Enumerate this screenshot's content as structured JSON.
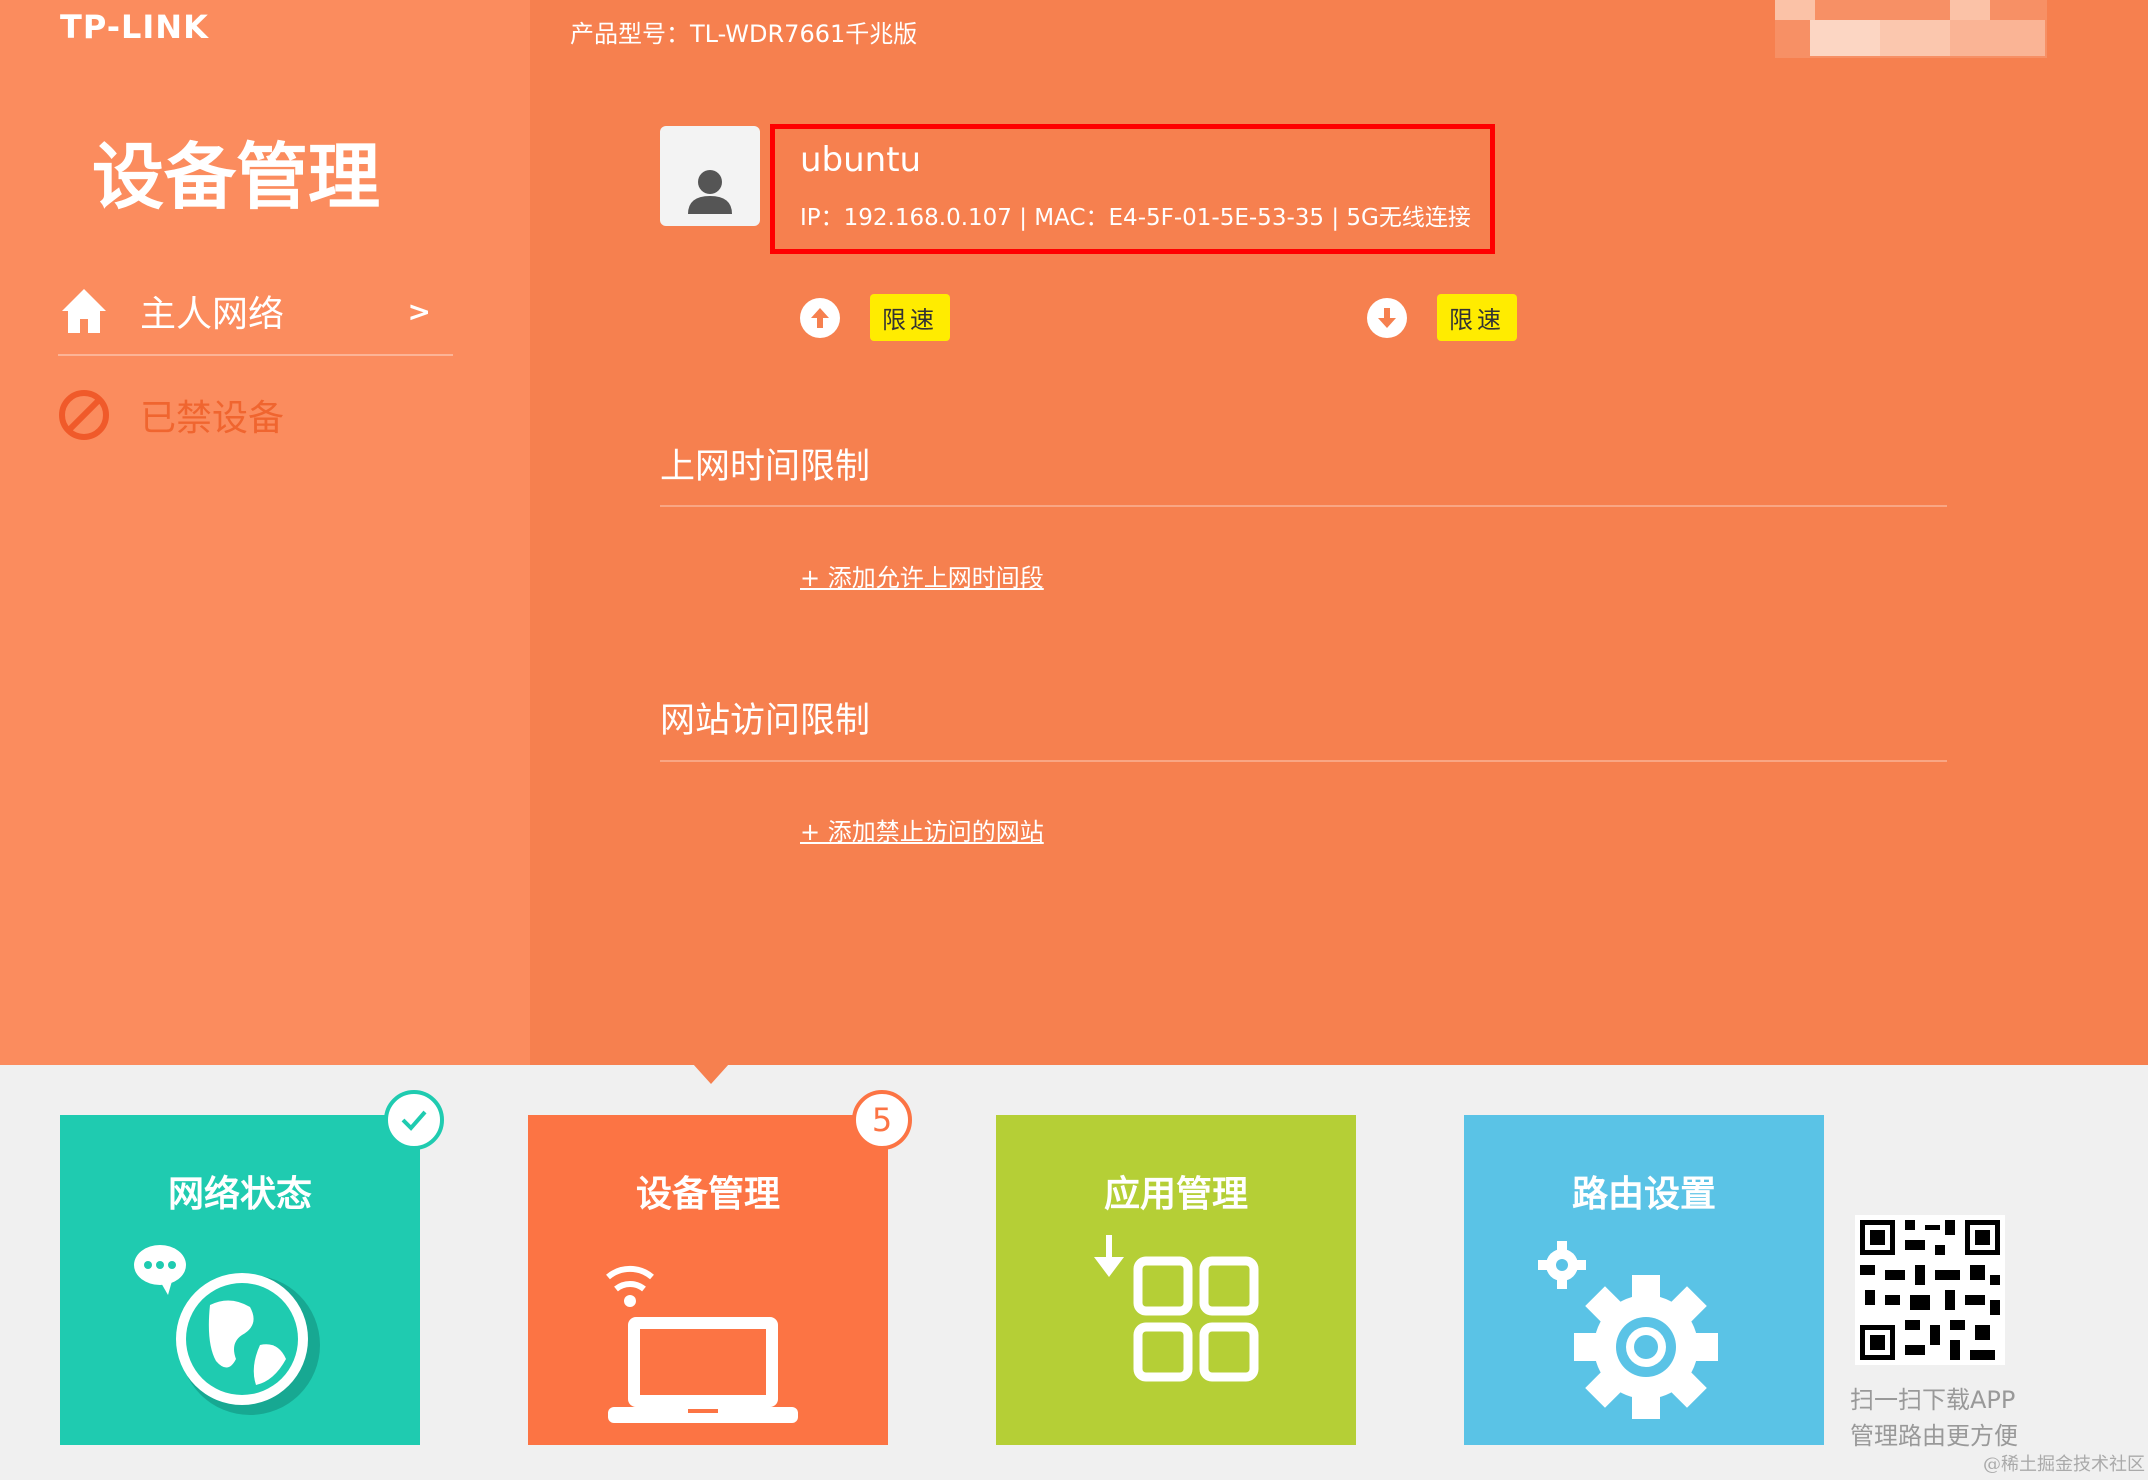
{
  "brand": "TP-LINK",
  "model": "产品型号：TL-WDR7661千兆版",
  "sidebar": {
    "title": "设备管理",
    "items": [
      {
        "label": "主人网络",
        "chevron": ">"
      },
      {
        "label": "已禁设备"
      }
    ]
  },
  "device": {
    "name": "ubuntu",
    "info": "IP：192.168.0.107 | MAC：E4-5F-01-5E-53-35 | 5G无线连接",
    "upload_limit": "限速",
    "download_limit": "限速"
  },
  "sections": {
    "time_title": "上网时间限制",
    "time_add": "+ 添加允许上网时间段",
    "site_title": "网站访问限制",
    "site_add": "+ 添加禁止访问的网站"
  },
  "tiles": [
    {
      "label": "网络状态"
    },
    {
      "label": "设备管理",
      "badge": "5"
    },
    {
      "label": "应用管理"
    },
    {
      "label": "路由设置"
    }
  ],
  "qr": {
    "line1": "扫一扫下载APP",
    "line2": "管理路由更方便"
  },
  "watermark": "@稀土掘金技术社区",
  "colors": {
    "main_bg": "#f6804f",
    "sidebar_bg": "#fb8c5e",
    "highlight": "#ff0000",
    "tag": "#ffec00",
    "tile_status": "#1fcbb0",
    "tile_devices": "#fc7444",
    "tile_apps": "#b5cf36",
    "tile_router": "#5ac3e6"
  }
}
